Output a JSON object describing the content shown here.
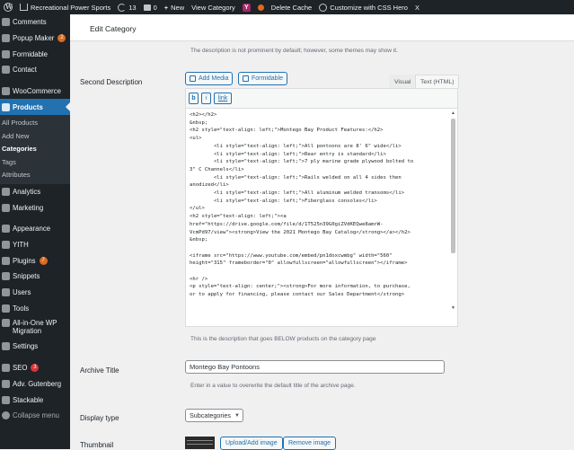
{
  "adminbar": {
    "site_name": "Recreational Power Sports",
    "updates_count": "13",
    "comments_count": "0",
    "new_label": "New",
    "view_category_label": "View Category",
    "delete_cache_label": "Delete Cache",
    "css_hero_label": "Customize with CSS Hero",
    "close_label": "X"
  },
  "sidebar": {
    "items": [
      {
        "label": "Comments"
      },
      {
        "label": "Popup Maker",
        "badge": "2"
      },
      {
        "label": "Formidable"
      },
      {
        "label": "Contact"
      },
      {
        "label": "WooCommerce"
      },
      {
        "label": "Products"
      },
      {
        "label": "Analytics"
      },
      {
        "label": "Marketing"
      },
      {
        "label": "Appearance"
      },
      {
        "label": "YITH"
      },
      {
        "label": "Plugins",
        "badge": "7"
      },
      {
        "label": "Snippets"
      },
      {
        "label": "Users"
      },
      {
        "label": "Tools"
      },
      {
        "label": "All-in-One WP Migration"
      },
      {
        "label": "Settings"
      },
      {
        "label": "SEO",
        "badge": "3"
      },
      {
        "label": "Adv. Gutenberg"
      },
      {
        "label": "Stackable"
      },
      {
        "label": "Collapse menu"
      }
    ],
    "submenu": [
      "All Products",
      "Add New",
      "Categories",
      "Tags",
      "Attributes"
    ]
  },
  "header": {
    "title": "Edit Category"
  },
  "top_description": "The description is not prominent by default; however, some themes may show it.",
  "second_description": {
    "label": "Second Description",
    "add_media": "Add Media",
    "formidable": "Formidable",
    "tab_visual": "Visual",
    "tab_text": "Text (HTML)",
    "qt_buttons": [
      "b",
      "i",
      "link"
    ],
    "content": "<h2></h2>\n&nbsp;\n<h2 style=\"text-align: left;\">Montego Bay Product Features:</h2>\n<ul>\n        <li style=\"text-align: left;\">All pontoons are 8' 6\" wide</li>\n        <li style=\"text-align: left;\">Rear entry is standard</li>\n        <li style=\"text-align: left;\">7 ply marine grade plywood bolted to\n3\" C Channels</li>\n        <li style=\"text-align: left;\">Rails welded on all 4 sides then\nanodized</li>\n        <li style=\"text-align: left;\">All aluminum welded transoms</li>\n        <li style=\"text-align: left;\">Fiberglass consoles</li>\n</ul>\n<h2 style=\"text-align: left;\"><a\nhref=\"https://drive.google.com/file/d/1T525n39G0giZVdKEQwe8amrW-\nVcmPd97/view\"><strong>View the 2021 Montego Bay Catalog</strong></a></h2>\n&nbsp;\n\n<iframe src=\"https://www.youtube.com/embed/pn1doxcwmbg\" width=\"560\"\nheight=\"315\" frameborder=\"0\" allowfullscreen=\"allowfullscreen\"></iframe>\n\n<hr />\n<p style=\"text-align: center;\"><strong>For more information, to purchase,\nor to apply for financing, please contact our Sales Department</strong>",
    "help": "This is the description that goes BELOW products on the category page"
  },
  "archive_title": {
    "label": "Archive Title",
    "value": "Montego Bay Pontoons",
    "help": "Enter in a value to overwrite the default title of the archive page."
  },
  "display_type": {
    "label": "Display type",
    "value": "Subcategories"
  },
  "thumbnail": {
    "label": "Thumbnail",
    "upload": "Upload/Add image",
    "remove": "Remove image"
  },
  "colors": {
    "accent": "#2271b1",
    "sidebar_bg": "#1d2327",
    "badge": "#d63638"
  }
}
